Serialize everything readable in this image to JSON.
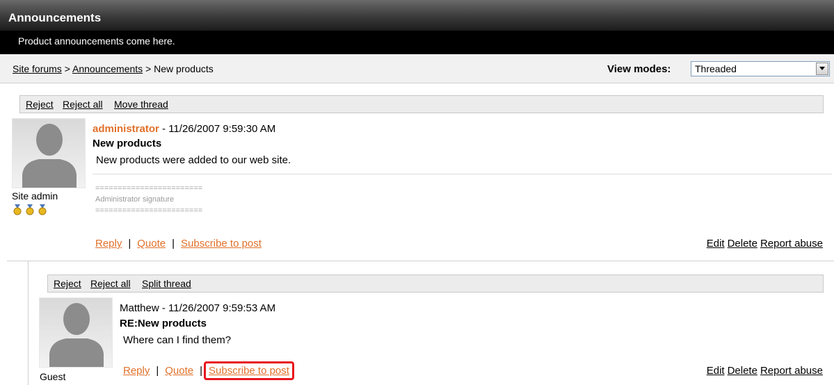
{
  "header": {
    "title": "Announcements",
    "subtitle": "Product announcements come here."
  },
  "breadcrumb": {
    "items": [
      "Site forums",
      "Announcements",
      "New products"
    ],
    "separator": " > "
  },
  "view_modes": {
    "label": "View modes:",
    "selected": "Threaded"
  },
  "posts": [
    {
      "moderation": [
        "Reject",
        "Reject all",
        "Move thread"
      ],
      "author": "administrator",
      "separator": " - ",
      "date": "11/26/2007 9:59:30 AM",
      "title": "New products",
      "body": "New products were added to our web site.",
      "signature": [
        "========================",
        "Administrator signature",
        "========================"
      ],
      "user_role": "Site admin",
      "actions": [
        "Reply",
        "Quote",
        "Subscribe to post"
      ],
      "manage": [
        "Edit",
        "Delete",
        "Report abuse"
      ]
    },
    {
      "moderation": [
        "Reject",
        "Reject all",
        "Split thread"
      ],
      "author": "Matthew",
      "separator": " - ",
      "date": "11/26/2007 9:59:53 AM",
      "title": "RE:New products",
      "body": "Where can I find them?",
      "user_role": "Guest",
      "actions": [
        "Reply",
        "Quote",
        "Subscribe to post"
      ],
      "manage": [
        "Edit",
        "Delete",
        "Report abuse"
      ]
    }
  ],
  "colors": {
    "accent": "#e0702a",
    "highlight": "#e8141c",
    "header_bg": "#000000"
  },
  "icons": {
    "avatar": "person-silhouette-icon",
    "badge": "gold-medal-icon",
    "dropdown": "chevron-down-icon"
  }
}
